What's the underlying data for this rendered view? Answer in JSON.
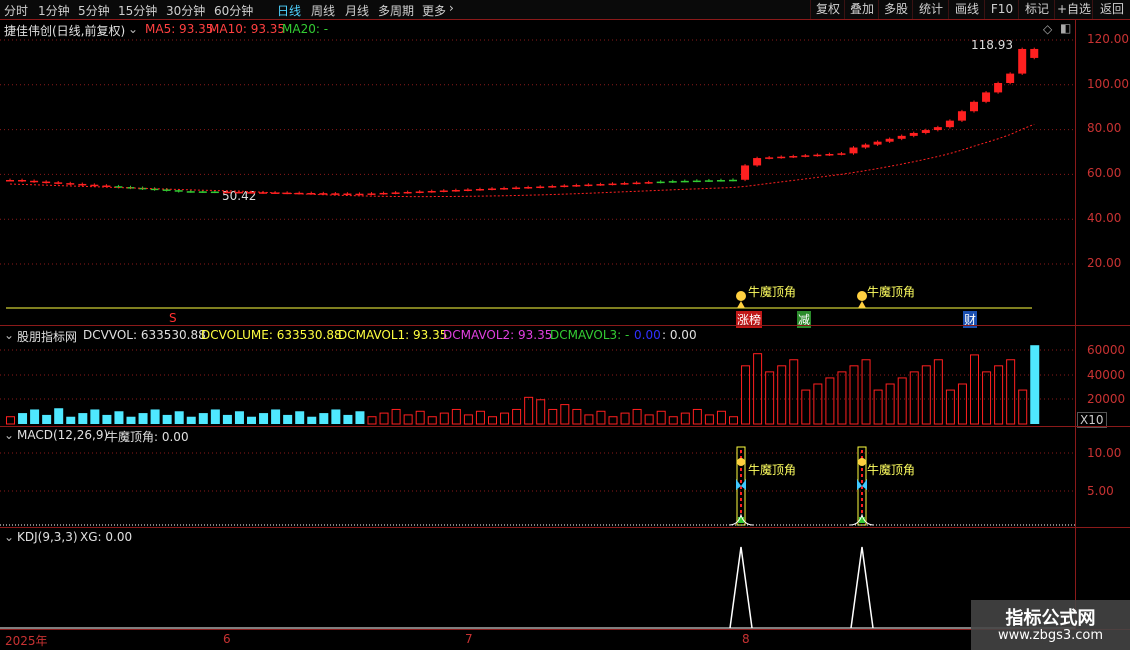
{
  "toolbar": {
    "periods": [
      "分时",
      "1分钟",
      "5分钟",
      "15分钟",
      "30分钟",
      "60分钟",
      "日线",
      "周线",
      "月线",
      "多周期",
      "更多"
    ],
    "active_period": "日线",
    "more_icon": "chevron-right-icon",
    "right_buttons": [
      "复权",
      "叠加",
      "多股",
      "统计",
      "画线",
      "F10",
      "标记",
      "+自选",
      "返回"
    ]
  },
  "main": {
    "stock_title": "捷佳伟创(日线,前复权)",
    "ma5": "MA5: 93.35",
    "ma10": "MA10: 93.35",
    "ma20": "MA20: -",
    "high_label": "118.93",
    "low_label": "50.42",
    "y_ticks": [
      "120.00",
      "100.00",
      "80.00",
      "60.00",
      "40.00",
      "20.00"
    ],
    "signals": {
      "s": "S",
      "zhangting": "涨榜",
      "jian": "减",
      "cai": "财",
      "niumo": "牛魔顶角"
    }
  },
  "vol": {
    "name": "股朋指标网",
    "dcvvol": "DCVVOL: 633530.88",
    "dcvolume": "DCVOLUME: 633530.88",
    "dcmavol1": "DCMAVOL1: 93.35",
    "dcmavol2": "DCMAVOL2: 93.35",
    "dcmavol3": "DCMAVOL3: -",
    "extra_a": "0.00",
    "extra_b": ": 0.00",
    "y_ticks": [
      "60000",
      "40000",
      "20000"
    ],
    "unit": "X10"
  },
  "macd": {
    "title": "MACD(12,26,9)",
    "value": "牛魔顶角: 0.00",
    "y_ticks": [
      "10.00",
      "5.00"
    ],
    "signal": "牛魔顶角"
  },
  "kdj": {
    "title": "KDJ(9,3,3)",
    "value": "XG: 0.00"
  },
  "xaxis": [
    "2025年",
    "6",
    "7",
    "8"
  ],
  "watermark": {
    "line1": "指标公式网",
    "line2": "www.zbgs3.com"
  },
  "colors": {
    "up": "#ff2020",
    "down": "#33cc33",
    "accent": "#4fd2ff",
    "grid": "#8b1a1a",
    "vol_down": "#4fe8ff"
  },
  "chart_data": {
    "type": "candlestick",
    "series": [
      {
        "name": "MA5",
        "value": 93.35
      },
      {
        "name": "MA10",
        "value": 93.35
      }
    ],
    "ylim": [
      0,
      125
    ],
    "y_ticks": [
      20,
      40,
      60,
      80,
      100,
      120
    ],
    "annotations": [
      {
        "text": "118.93",
        "kind": "high"
      },
      {
        "text": "50.42",
        "kind": "low"
      }
    ],
    "volume": {
      "ylim": [
        0,
        70000
      ],
      "y_ticks": [
        20000,
        40000,
        60000
      ]
    },
    "macd": {
      "ylim": [
        0,
        14
      ],
      "y_ticks": [
        5,
        10
      ]
    }
  }
}
